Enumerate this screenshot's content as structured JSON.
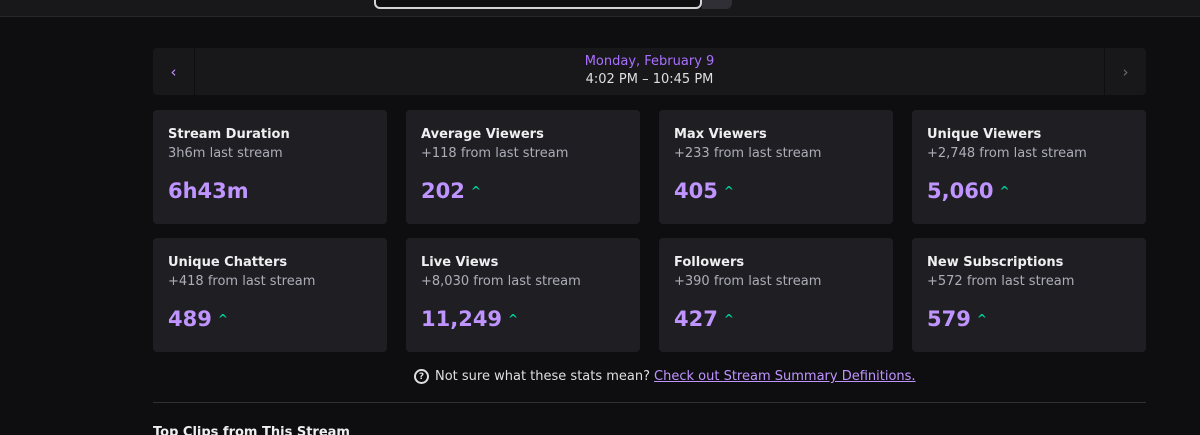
{
  "date_nav": {
    "prev_icon": "‹",
    "next_icon": "›",
    "day": "Monday, February 9",
    "time_range": "4:02 PM – 10:45 PM"
  },
  "stats": [
    {
      "title": "Stream Duration",
      "delta": "3h6m last stream",
      "value": "6h43m",
      "trend": ""
    },
    {
      "title": "Average Viewers",
      "delta": "+118 from last stream",
      "value": "202",
      "trend": "^"
    },
    {
      "title": "Max Viewers",
      "delta": "+233 from last stream",
      "value": "405",
      "trend": "^"
    },
    {
      "title": "Unique Viewers",
      "delta": "+2,748 from last stream",
      "value": "5,060",
      "trend": "^"
    },
    {
      "title": "Unique Chatters",
      "delta": "+418 from last stream",
      "value": "489",
      "trend": "^"
    },
    {
      "title": "Live Views",
      "delta": "+8,030 from last stream",
      "value": "11,249",
      "trend": "^"
    },
    {
      "title": "Followers",
      "delta": "+390 from last stream",
      "value": "427",
      "trend": "^"
    },
    {
      "title": "New Subscriptions",
      "delta": "+572 from last stream",
      "value": "579",
      "trend": "^"
    }
  ],
  "help": {
    "icon": "?",
    "text": "Not sure what these stats mean?",
    "link": "Check out Stream Summary Definitions."
  },
  "section_title": "Top Clips from This Stream",
  "colors": {
    "accent": "#bf94ff",
    "trend_up": "#00c896",
    "card_bg": "#1f1f23",
    "page_bg": "#0e0e10"
  }
}
